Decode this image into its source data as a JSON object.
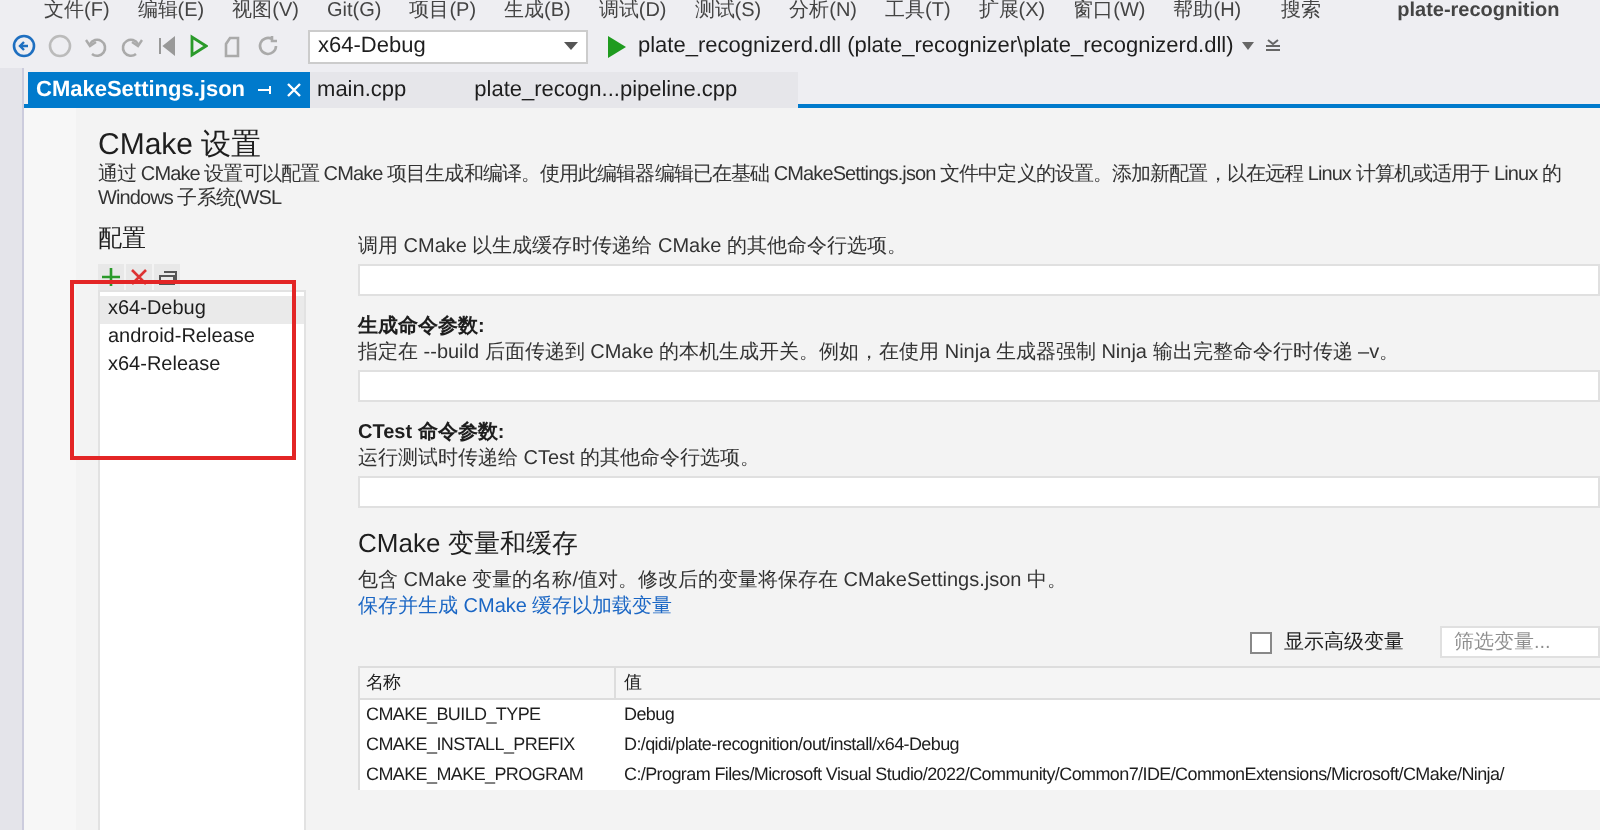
{
  "menu_bar": {
    "items": [
      "文件(F)",
      "编辑(E)",
      "视图(V)",
      "Git(G)",
      "项目(P)",
      "生成(B)",
      "调试(D)",
      "测试(S)",
      "分析(N)",
      "工具(T)",
      "扩展(X)",
      "窗口(W)",
      "帮助(H)"
    ],
    "search": "搜索",
    "project_title": "plate-recognition"
  },
  "toolbar": {
    "configuration": "x64-Debug",
    "startup_item": "plate_recognizerd.dll (plate_recognizer\\plate_recognizerd.dll)"
  },
  "tabs": [
    {
      "label": "CMakeSettings.json",
      "selected": true
    },
    {
      "label": "main.cpp",
      "selected": false
    },
    {
      "label": "plate_recogn...pipeline.cpp",
      "selected": false
    }
  ],
  "page": {
    "title": "CMake 设置",
    "description": "通过 CMake 设置可以配置 CMake 项目生成和编译。使用此编辑器编辑已在基础 CMakeSettings.json 文件中定义的设置。添加新配置，以在远程 Linux 计算机或适用于 Linux 的 Windows 子系统(WSL",
    "configurations": {
      "heading": "配置",
      "items": [
        {
          "label": "x64-Debug",
          "selected": true
        },
        {
          "label": "android-Release",
          "selected": false
        },
        {
          "label": "x64-Release",
          "selected": false
        }
      ]
    },
    "sections": [
      {
        "description": "调用 CMake 以生成缓存时传递给 CMake 的其他命令行选项。"
      },
      {
        "label": "生成命令参数:",
        "description": "指定在 --build 后面传递到 CMake 的本机生成开关。例如，在使用 Ninja 生成器强制 Ninja 输出完整命令行时传递 –v。"
      },
      {
        "label": "CTest 命令参数:",
        "description": "运行测试时传递给 CTest 的其他命令行选项。"
      }
    ],
    "variables": {
      "title": "CMake 变量和缓存",
      "description": "包含 CMake 变量的名称/值对。修改后的变量将保存在 CMakeSettings.json 中。",
      "link": "保存并生成 CMake 缓存以加载变量",
      "show_advanced": {
        "label": "显示高级变量",
        "checked": false
      },
      "filter": {
        "placeholder": "筛选变量..."
      },
      "columns": [
        "名称",
        "值"
      ],
      "rows": [
        [
          "CMAKE_BUILD_TYPE",
          "Debug"
        ],
        [
          "CMAKE_INSTALL_PREFIX",
          "D:/qidi/plate-recognition/out/install/x64-Debug"
        ],
        [
          "CMAKE_MAKE_PROGRAM",
          "C:/Program Files/Microsoft Visual Studio/2022/Community/Common7/IDE/CommonExtensions/Microsoft/CMake/Ninja/"
        ]
      ]
    }
  }
}
